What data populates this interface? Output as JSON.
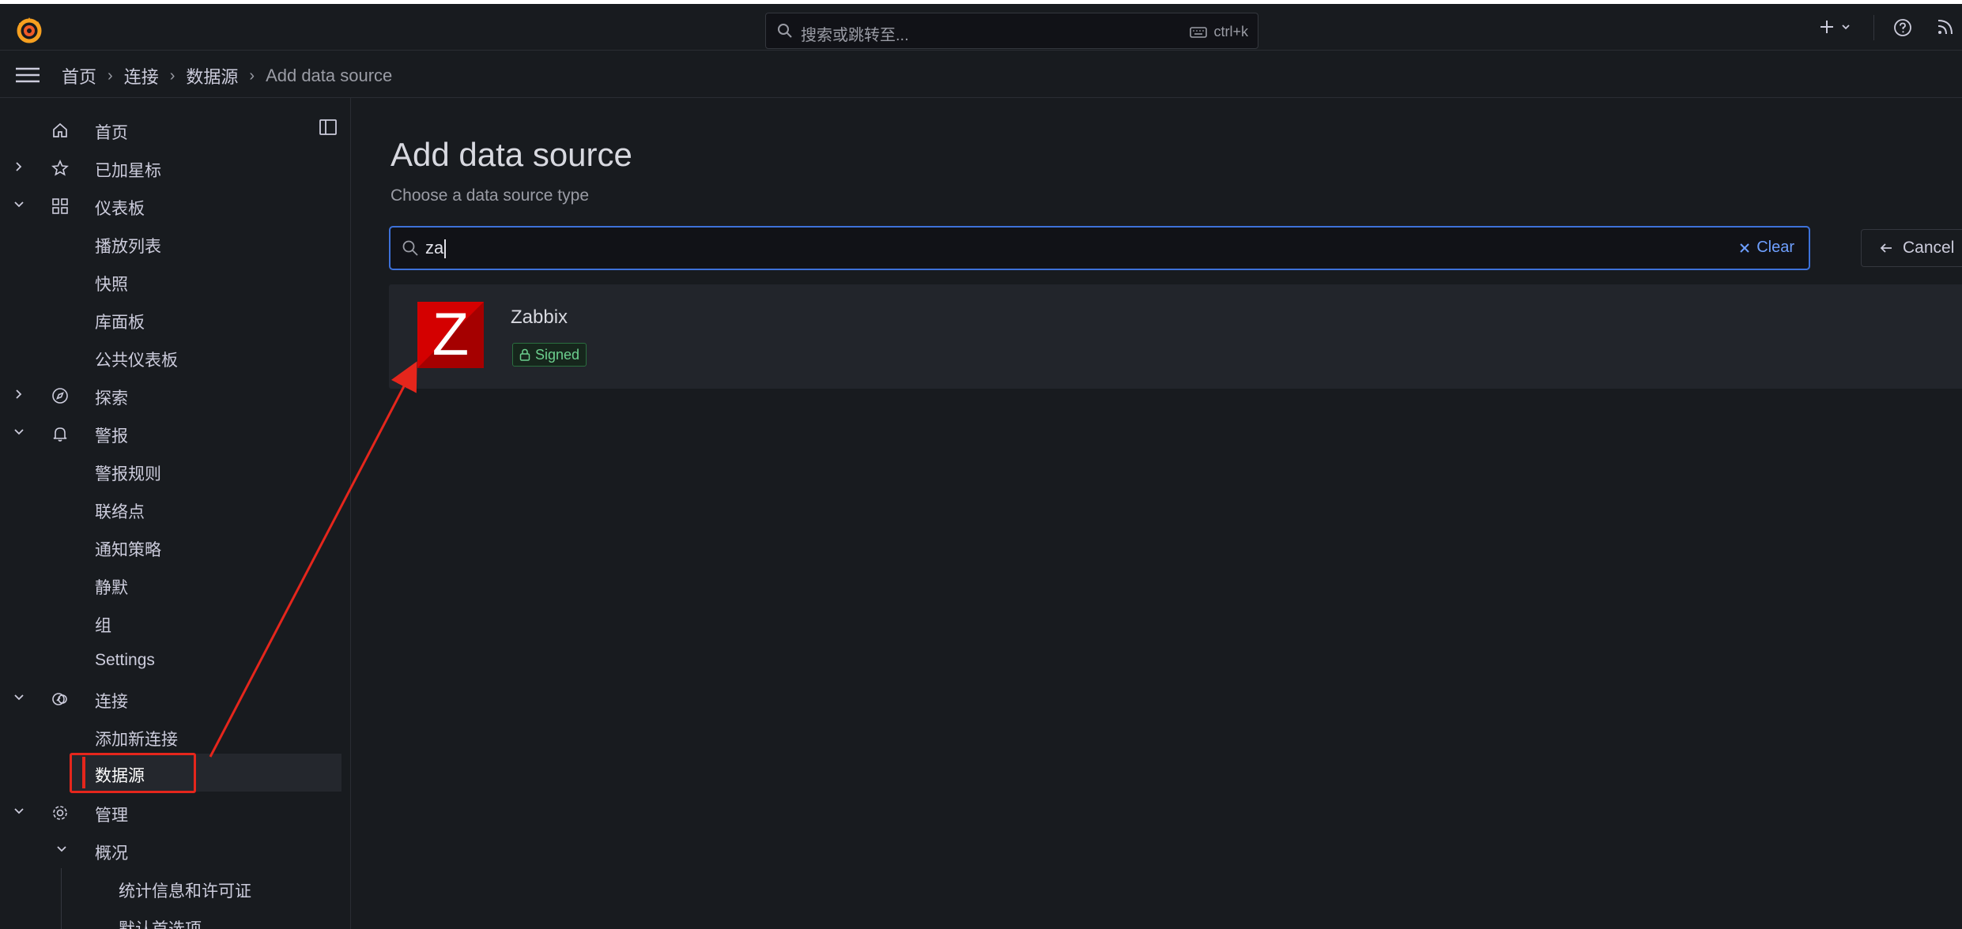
{
  "topbar": {
    "search_placeholder": "搜索或跳转至...",
    "shortcut": "ctrl+k"
  },
  "breadcrumb": [
    "首页",
    "连接",
    "数据源",
    "Add data source"
  ],
  "sidebar": {
    "items": [
      {
        "label": "首页",
        "icon": "home-icon"
      },
      {
        "label": "已加星标",
        "icon": "star-icon"
      },
      {
        "label": "仪表板",
        "icon": "apps-icon"
      },
      {
        "label": "播放列表"
      },
      {
        "label": "快照"
      },
      {
        "label": "库面板"
      },
      {
        "label": "公共仪表板"
      },
      {
        "label": "探索",
        "icon": "compass-icon"
      },
      {
        "label": "警报",
        "icon": "bell-icon"
      },
      {
        "label": "警报规则"
      },
      {
        "label": "联络点"
      },
      {
        "label": "通知策略"
      },
      {
        "label": "静默"
      },
      {
        "label": "组"
      },
      {
        "label": "Settings"
      },
      {
        "label": "连接",
        "icon": "connections-icon"
      },
      {
        "label": "添加新连接"
      },
      {
        "label": "数据源",
        "active": true
      },
      {
        "label": "管理",
        "icon": "cog-icon"
      },
      {
        "label": "概况"
      },
      {
        "label": "统计信息和许可证"
      },
      {
        "label": "默认首选项"
      }
    ]
  },
  "main": {
    "title": "Add data source",
    "subtitle": "Choose a data source type",
    "filter_value": "za",
    "clear_label": "Clear",
    "cancel_label": "Cancel",
    "results": [
      {
        "name": "Zabbix",
        "logo_letter": "Z",
        "badge": "Signed"
      }
    ]
  },
  "colors": {
    "background": "#181b1f",
    "accent_blue": "#3d71d9",
    "annotation_red": "#e5261c",
    "zabbix_red": "#d40000",
    "signed_green": "#6ccf8e"
  }
}
